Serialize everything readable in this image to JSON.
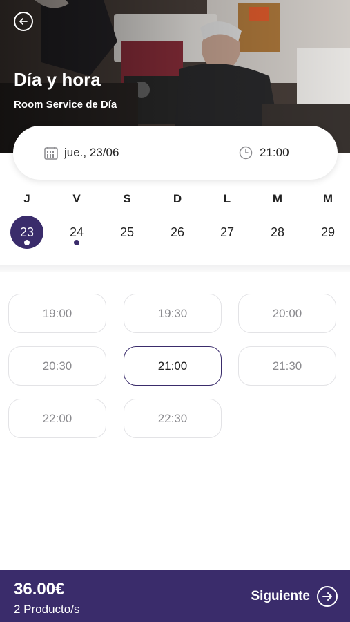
{
  "header": {
    "title": "Día y hora",
    "subtitle": "Room Service de Día",
    "back_icon": "arrow-left-circle-icon"
  },
  "summary": {
    "date_label": "jue., 23/06",
    "time_label": "21:00",
    "date_icon": "calendar-icon",
    "time_icon": "clock-icon"
  },
  "week": {
    "days": [
      {
        "letter": "J",
        "number": "23",
        "selected": true,
        "has_dot": true
      },
      {
        "letter": "V",
        "number": "24",
        "selected": false,
        "has_dot": true
      },
      {
        "letter": "S",
        "number": "25",
        "selected": false,
        "has_dot": false
      },
      {
        "letter": "D",
        "number": "26",
        "selected": false,
        "has_dot": false
      },
      {
        "letter": "L",
        "number": "27",
        "selected": false,
        "has_dot": false
      },
      {
        "letter": "M",
        "number": "28",
        "selected": false,
        "has_dot": false
      },
      {
        "letter": "M",
        "number": "29",
        "selected": false,
        "has_dot": false
      }
    ]
  },
  "slots": [
    {
      "time": "19:00",
      "selected": false
    },
    {
      "time": "19:30",
      "selected": false
    },
    {
      "time": "20:00",
      "selected": false
    },
    {
      "time": "20:30",
      "selected": false
    },
    {
      "time": "21:00",
      "selected": true
    },
    {
      "time": "21:30",
      "selected": false
    },
    {
      "time": "22:00",
      "selected": false
    },
    {
      "time": "22:30",
      "selected": false
    }
  ],
  "footer": {
    "price": "36.00€",
    "products": "2 Producto/s",
    "next_label": "Siguiente",
    "next_icon": "arrow-right-circle-icon"
  },
  "colors": {
    "accent": "#3a2c6b",
    "slot_border": "#e3e3e6",
    "slot_text": "#8b8b8f"
  }
}
